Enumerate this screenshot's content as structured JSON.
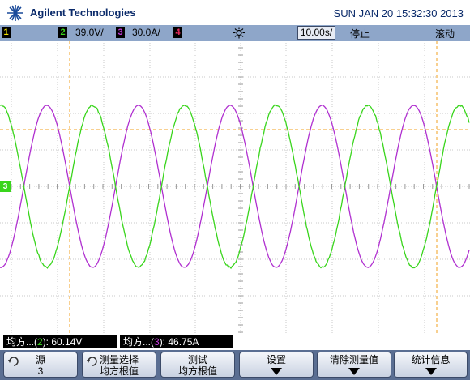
{
  "header": {
    "brand": "Agilent Technologies",
    "datetime": "SUN JAN 20 15:32:30 2013"
  },
  "channel_bar": {
    "ch1": {
      "num": "1",
      "color": "#f2e200"
    },
    "ch2": {
      "num": "2",
      "scale": "39.0V/",
      "color": "#39d51c"
    },
    "ch3": {
      "num": "3",
      "scale": "30.0A/",
      "color": "#c53bdc"
    },
    "ch4": {
      "num": "4",
      "color": "#ea2c5e"
    },
    "trigger_icon": "sun-trigger-icon",
    "timebase": "10.00s/",
    "run_state": "停止",
    "mode": "滚动"
  },
  "display": {
    "ground_marker": "3",
    "cursor_color": "#f0a020",
    "waveforms": [
      {
        "channel": "2",
        "color": "#39d51c",
        "shape": "sine",
        "phase": "opposite"
      },
      {
        "channel": "3",
        "color": "#b030d0",
        "shape": "sine"
      }
    ]
  },
  "measurements": [
    {
      "prefix": "均方...(",
      "ch": "2",
      "suffix": "): 60.14V",
      "ch_color": "#39d51c"
    },
    {
      "prefix": "均方...(",
      "ch": "3",
      "suffix": "): 46.75A",
      "ch_color": "#c53bdc"
    }
  ],
  "softkeys": [
    {
      "line1": "源",
      "line2": "3",
      "icon": "rotate-knob-icon"
    },
    {
      "line1": "测量选择",
      "line2": "均方根值",
      "icon": "rotate-knob-icon"
    },
    {
      "line1": "测试",
      "line2": "均方根值"
    },
    {
      "line1": "设置",
      "icon": "down-arrow-icon"
    },
    {
      "line1": "清除测量值",
      "icon": "down-arrow-icon"
    },
    {
      "line1": "统计信息",
      "icon": "down-arrow-icon"
    }
  ]
}
